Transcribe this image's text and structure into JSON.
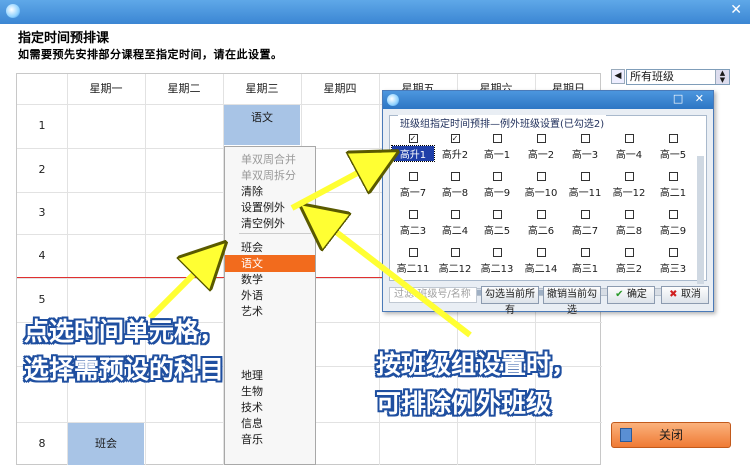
{
  "window": {
    "title": "指定时间预排课",
    "subtitle": "如需要预先安排部分课程至指定时间，请在此设置。",
    "close_glyph": "✕"
  },
  "filter_combo": {
    "value": "所有班级",
    "arrow_glyph": "◀"
  },
  "timetable": {
    "days": [
      "星期一",
      "星期二",
      "星期三",
      "星期四",
      "星期五",
      "星期六",
      "星期日"
    ],
    "periods": [
      "1",
      "2",
      "3",
      "4",
      "5",
      "",
      "",
      "8"
    ],
    "cells": {
      "wed_p1": "语文",
      "mon_p8": "班会"
    }
  },
  "context_menu": {
    "items": [
      "单双周合并",
      "单双周拆分",
      "清除",
      "设置例外",
      "清空例外",
      "班会",
      "语文",
      "数学",
      "外语",
      "艺术",
      "",
      "",
      "",
      "地理",
      "生物",
      "技术",
      "信息",
      "音乐"
    ]
  },
  "dialog": {
    "legend": "班级组指定时间预排—例外班级设置(已勾选2)",
    "classes": [
      {
        "label": "高升1",
        "checked": true
      },
      {
        "label": "高升2",
        "checked": true
      },
      {
        "label": "高一1",
        "checked": false
      },
      {
        "label": "高一2",
        "checked": false
      },
      {
        "label": "高一3",
        "checked": false
      },
      {
        "label": "高一4",
        "checked": false
      },
      {
        "label": "高一5",
        "checked": false
      },
      {
        "label": "高一7",
        "checked": false
      },
      {
        "label": "高一8",
        "checked": false
      },
      {
        "label": "高一9",
        "checked": false
      },
      {
        "label": "高一10",
        "checked": false
      },
      {
        "label": "高一11",
        "checked": false
      },
      {
        "label": "高一12",
        "checked": false
      },
      {
        "label": "高二1",
        "checked": false
      },
      {
        "label": "高二3",
        "checked": false
      },
      {
        "label": "高二4",
        "checked": false
      },
      {
        "label": "高二5",
        "checked": false
      },
      {
        "label": "高二6",
        "checked": false
      },
      {
        "label": "高二7",
        "checked": false
      },
      {
        "label": "高二8",
        "checked": false
      },
      {
        "label": "高二9",
        "checked": false
      },
      {
        "label": "高二11",
        "checked": false
      },
      {
        "label": "高二12",
        "checked": false
      },
      {
        "label": "高二13",
        "checked": false
      },
      {
        "label": "高二14",
        "checked": false
      },
      {
        "label": "高三1",
        "checked": false
      },
      {
        "label": "高三2",
        "checked": false
      },
      {
        "label": "高三3",
        "checked": false
      }
    ],
    "filter_placeholder": "过滤:班级号/名称",
    "select_all_label": "勾选当前所有",
    "unselect_all_label": "撤销当前勾选",
    "ok_label": "确定",
    "cancel_label": "取消",
    "title_buttons": "□ ✕"
  },
  "close_button_label": "关闭",
  "annotations": {
    "left_line1": "点选时间单元格，",
    "left_line2": "选择需预设的科目",
    "right_line1": "按班级组设置时，",
    "right_line2": "可排除例外班级"
  },
  "colors": {
    "accent": "#f26b1d",
    "selection": "#a8c4e6",
    "annotation_fill": "#ffffff",
    "annotation_outline": "#1f4fa0",
    "arrow": "#ffff33"
  }
}
